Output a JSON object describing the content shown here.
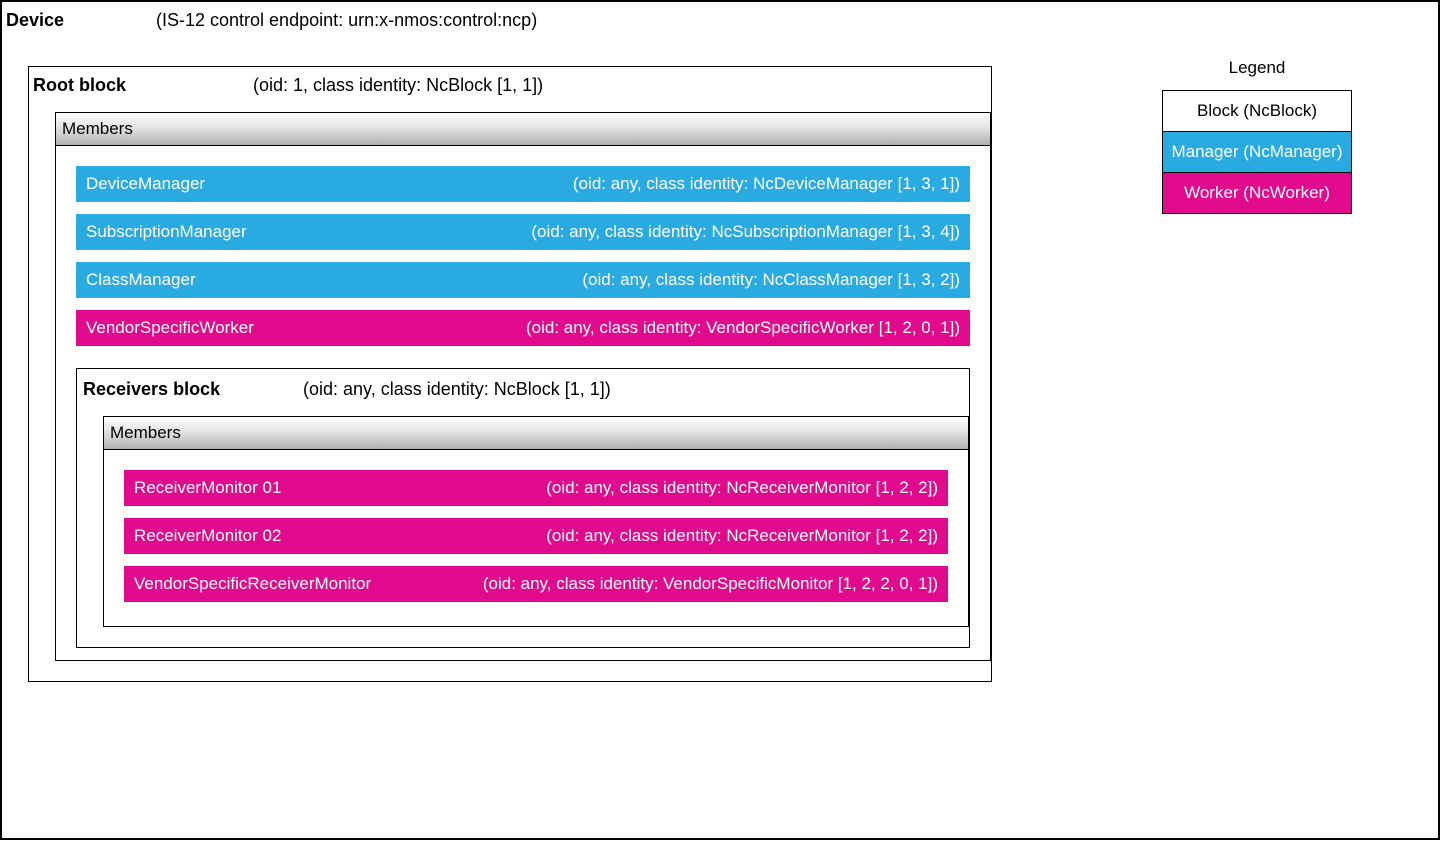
{
  "device": {
    "title": "Device",
    "meta": "(IS-12 control endpoint: urn:x-nmos:control:ncp)"
  },
  "root_block": {
    "title": "Root block",
    "meta": "(oid: 1, class identity: NcBlock [1, 1])",
    "members_label": "Members",
    "members": [
      {
        "name": "DeviceManager",
        "meta": "(oid: any, class identity: NcDeviceManager [1, 3, 1])",
        "type": "manager"
      },
      {
        "name": "SubscriptionManager",
        "meta": "(oid: any, class identity: NcSubscriptionManager [1, 3, 4])",
        "type": "manager"
      },
      {
        "name": "ClassManager",
        "meta": "(oid: any, class identity: NcClassManager [1, 3, 2])",
        "type": "manager"
      },
      {
        "name": "VendorSpecificWorker",
        "meta": "(oid: any, class identity: VendorSpecificWorker [1, 2, 0, 1])",
        "type": "worker"
      }
    ]
  },
  "receivers_block": {
    "title": "Receivers block",
    "meta": "(oid: any, class identity: NcBlock [1, 1])",
    "members_label": "Members",
    "members": [
      {
        "name": "ReceiverMonitor 01",
        "meta": "(oid: any, class identity: NcReceiverMonitor [1, 2, 2])",
        "type": "worker"
      },
      {
        "name": "ReceiverMonitor 02",
        "meta": "(oid: any, class identity: NcReceiverMonitor [1, 2, 2])",
        "type": "worker"
      },
      {
        "name": "VendorSpecificReceiverMonitor",
        "meta": "(oid: any, class identity: VendorSpecificMonitor [1, 2, 2, 0, 1])",
        "type": "worker"
      }
    ]
  },
  "legend": {
    "title": "Legend",
    "block": "Block (NcBlock)",
    "manager": "Manager (NcManager)",
    "worker": "Worker (NcWorker)"
  }
}
